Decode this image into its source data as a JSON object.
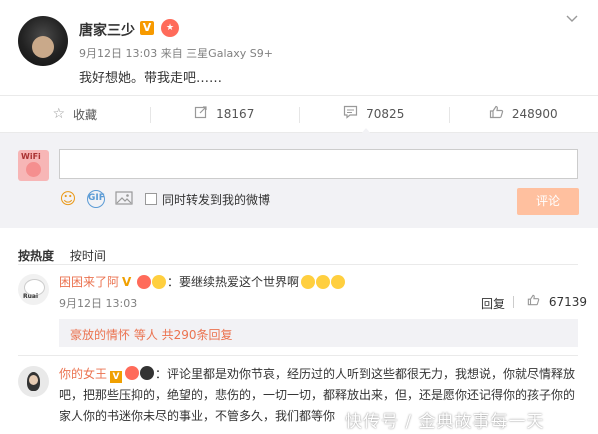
{
  "post": {
    "author": "唐家三少",
    "verified_badge": "V",
    "meta": "9月12日 13:03 来自 三星Galaxy S9+",
    "content": "我好想她。带我走吧……",
    "menu_icon": "chevron-down-icon"
  },
  "actions": [
    {
      "icon": "star-icon",
      "label": "收藏"
    },
    {
      "icon": "share-icon",
      "label": "18167"
    },
    {
      "icon": "comment-icon",
      "label": "70825"
    },
    {
      "icon": "like-icon",
      "label": "248900"
    }
  ],
  "comment_box": {
    "placeholder": "",
    "repost_label": "同时转发到我的微博",
    "submit_label": "评论",
    "avatar_text": "WiFi"
  },
  "sort": {
    "hot_label": "按热度",
    "time_label": "按时间"
  },
  "comments": [
    {
      "user": "困困来了阿",
      "text": "：要继续热爱这个世界啊",
      "time": "9月12日 13:03",
      "reply_label": "回复",
      "likes": "67139",
      "avatar_text": "Ruai",
      "subreplies": {
        "first_user": "豪放的情怀",
        "suffix": " 等人 共290条回复"
      }
    },
    {
      "user": "你的女王",
      "text": "：评论里都是劝你节哀，经历过的人听到这些都很无力，我想说，你就尽情释放吧，把那些压抑的，绝望的，悲伤的，一切一切，都释放出来，但，还是愿你还记得你的孩子你的家人你的书迷你未尽的事业，不管多久，我们都等你"
    }
  ],
  "watermark": "快传号 / 金典故事每一天",
  "colors": {
    "accent": "#eb7350",
    "submit_bg": "#ffc09f",
    "panel_bg": "#f2f2f5",
    "verified": "#f79a00"
  }
}
